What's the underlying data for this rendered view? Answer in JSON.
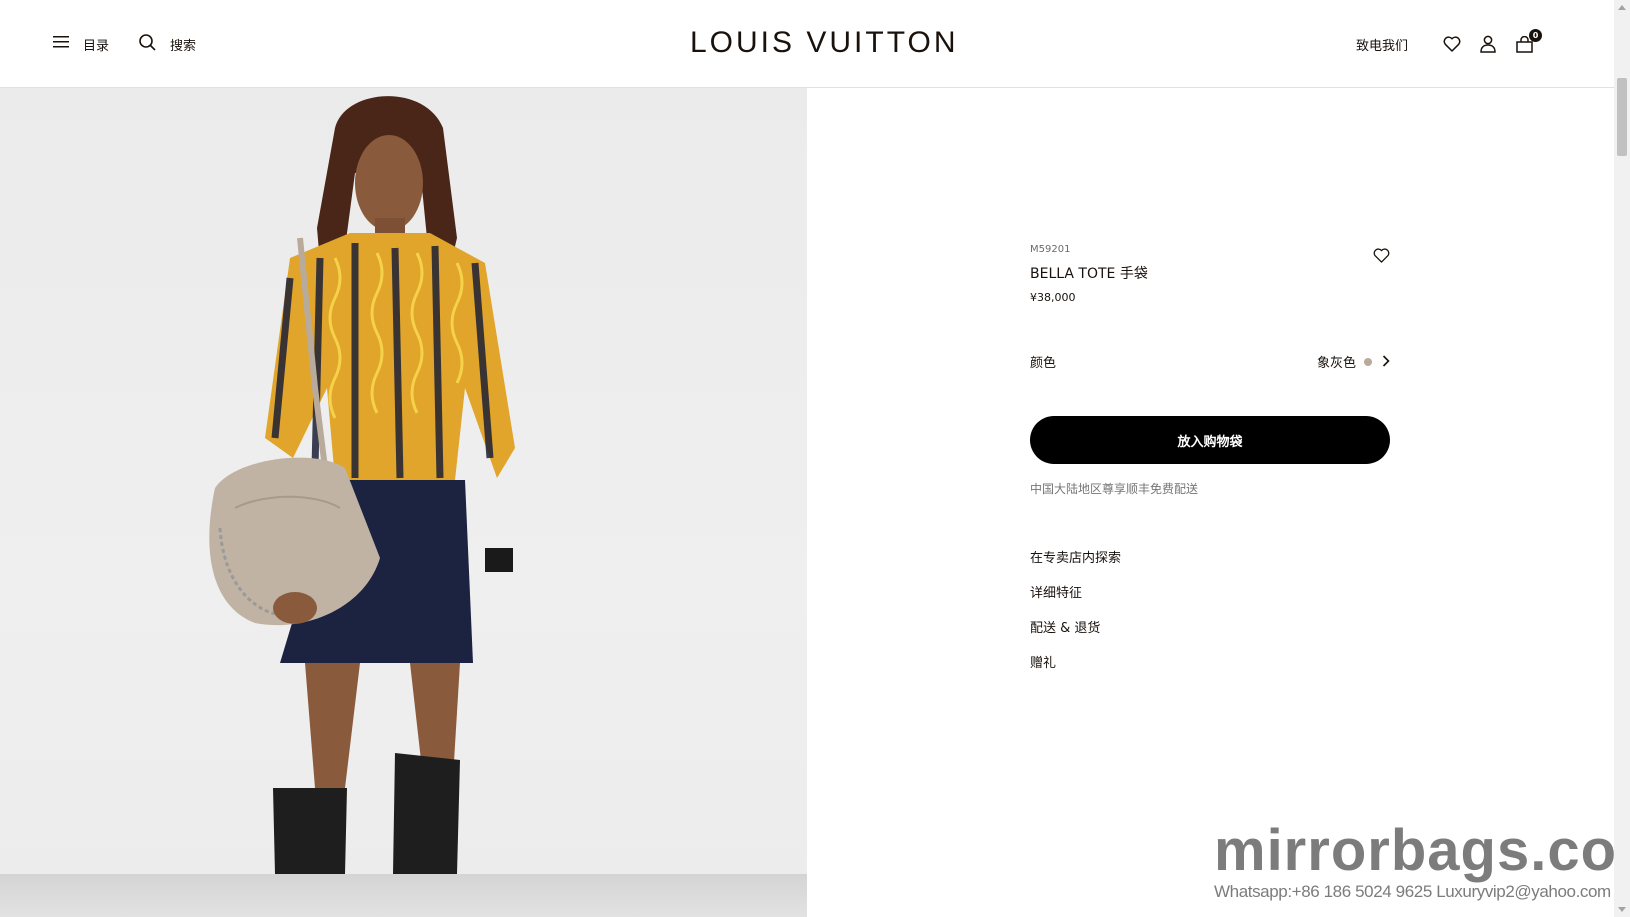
{
  "header": {
    "menu_label": "目录",
    "search_label": "搜索",
    "logo_text": "LOUIS VUITTON",
    "call_label": "致电我们",
    "bag_count": "0"
  },
  "product": {
    "sku": "M59201",
    "name": "BELLA TOTE 手袋",
    "price": "¥38,000",
    "color_label": "颜色",
    "color_value": "象灰色",
    "color_swatch": "#b9ab9b",
    "add_to_bag": "放入购物袋",
    "shipping_note": "中国大陆地区尊享顺丰免费配送",
    "links": [
      "在专卖店内探索",
      "详细特征",
      "配送 & 退货",
      "赠礼"
    ]
  },
  "watermark": {
    "site": "mirrorbags.com",
    "contact": "Whatsapp:+86 186 5024 9625   Luxuryvip2@yahoo.com"
  },
  "icons": {
    "menu": "hamburger-icon",
    "search": "search-icon",
    "wishlist": "heart-icon",
    "account": "person-icon",
    "bag": "shopping-bag-icon",
    "chevron": "chevron-right-icon"
  }
}
